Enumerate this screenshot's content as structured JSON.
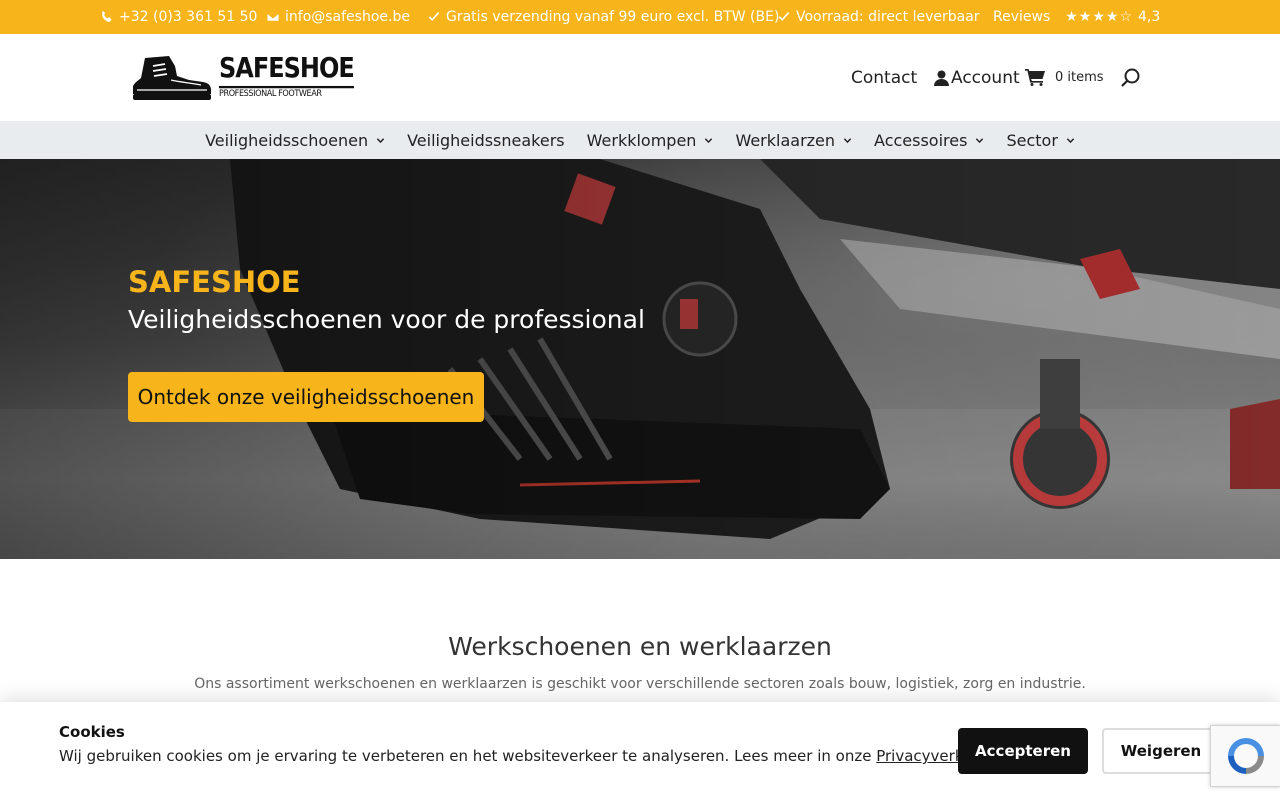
{
  "topbar": {
    "phone": "+32 (0)3 361 51 50",
    "email": "info@safeshoe.be",
    "shipping": "Gratis verzending vanaf 99 euro excl. BTW (BE)",
    "stock": "Voorraad: direct leverbaar",
    "reviews_label": "Reviews",
    "stars": "★★★★☆",
    "rating": "4,3"
  },
  "header": {
    "logo_name": "SAFESHOE",
    "logo_tagline": "PROFESSIONAL FOOTWEAR",
    "contact": "Contact",
    "account": "Account",
    "cart_count": "0 items"
  },
  "nav": {
    "items": [
      {
        "label": "Veiligheidsschoenen",
        "has_dropdown": true
      },
      {
        "label": "Veiligheidssneakers",
        "has_dropdown": false
      },
      {
        "label": "Werkklompen",
        "has_dropdown": true
      },
      {
        "label": "Werklaarzen",
        "has_dropdown": true
      },
      {
        "label": "Accessoires",
        "has_dropdown": true
      },
      {
        "label": "Sector",
        "has_dropdown": true
      }
    ]
  },
  "hero": {
    "title": "SAFESHOE",
    "subtitle": "Veiligheidsschoenen voor de professional",
    "cta": "Ontdek onze veiligheidsschoenen"
  },
  "section": {
    "title": "Werkschoenen en werklaarzen",
    "subtitle": "Ons assortiment werkschoenen en werklaarzen is geschikt voor verschillende sectoren zoals bouw, logistiek, zorg en industrie."
  },
  "cookie": {
    "title": "Cookies",
    "text": "Wij gebruiken cookies om je ervaring te verbeteren en het websiteverkeer te analyseren. Lees meer in onze ",
    "link": "Privacyverklaring",
    "after_link": ".",
    "accept": "Accepteren",
    "decline": "Weigeren"
  },
  "colors": {
    "brand_yellow": "#f7b51b",
    "nav_bg": "#e9ecef",
    "dark": "#111111"
  },
  "icons": [
    "phone-icon",
    "envelope-icon",
    "check-icon",
    "user-icon",
    "cart-icon",
    "search-icon",
    "chevron-down-icon",
    "recaptcha-icon"
  ]
}
